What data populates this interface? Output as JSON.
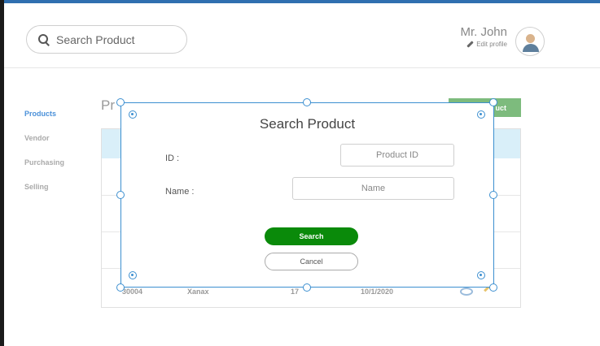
{
  "header": {
    "search_placeholder": "Search Product",
    "user_name": "Mr. John",
    "edit_profile": "Edit profile"
  },
  "sidebar": {
    "items": [
      {
        "label": "Products",
        "active": true
      },
      {
        "label": "Vendor",
        "active": false
      },
      {
        "label": "Purchasing",
        "active": false
      },
      {
        "label": "Selling",
        "active": false
      }
    ]
  },
  "background": {
    "page_title": "Pr",
    "add_button": "uct",
    "visible_row": {
      "id": "30004",
      "name": "Xanax",
      "qty": "17",
      "date": "10/1/2020"
    }
  },
  "dialog": {
    "title": "Search Product",
    "id_label": "ID :",
    "id_placeholder": "Product ID",
    "name_label": "Name :",
    "name_placeholder": "Name",
    "search_button": "Search",
    "cancel_button": "Cancel"
  },
  "colors": {
    "accent": "#3c8fd0",
    "search_button": "#0a8a0a",
    "add_button": "#7dbb7d",
    "table_header": "#d9eff9"
  }
}
